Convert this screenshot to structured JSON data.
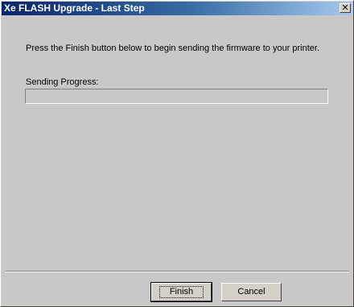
{
  "window": {
    "title": "Xe FLASH Upgrade - Last Step",
    "close_label": "✕"
  },
  "main": {
    "instruction": "Press the Finish button below to begin sending the firmware to your printer.",
    "progress_label": "Sending Progress:",
    "progress_value": 0
  },
  "buttons": {
    "finish_label": "Finish",
    "cancel_label": "Cancel"
  },
  "colors": {
    "title_gradient_start": "#0a246a",
    "title_gradient_end": "#a6caf0",
    "dialog_background": "#c8c8c8"
  }
}
